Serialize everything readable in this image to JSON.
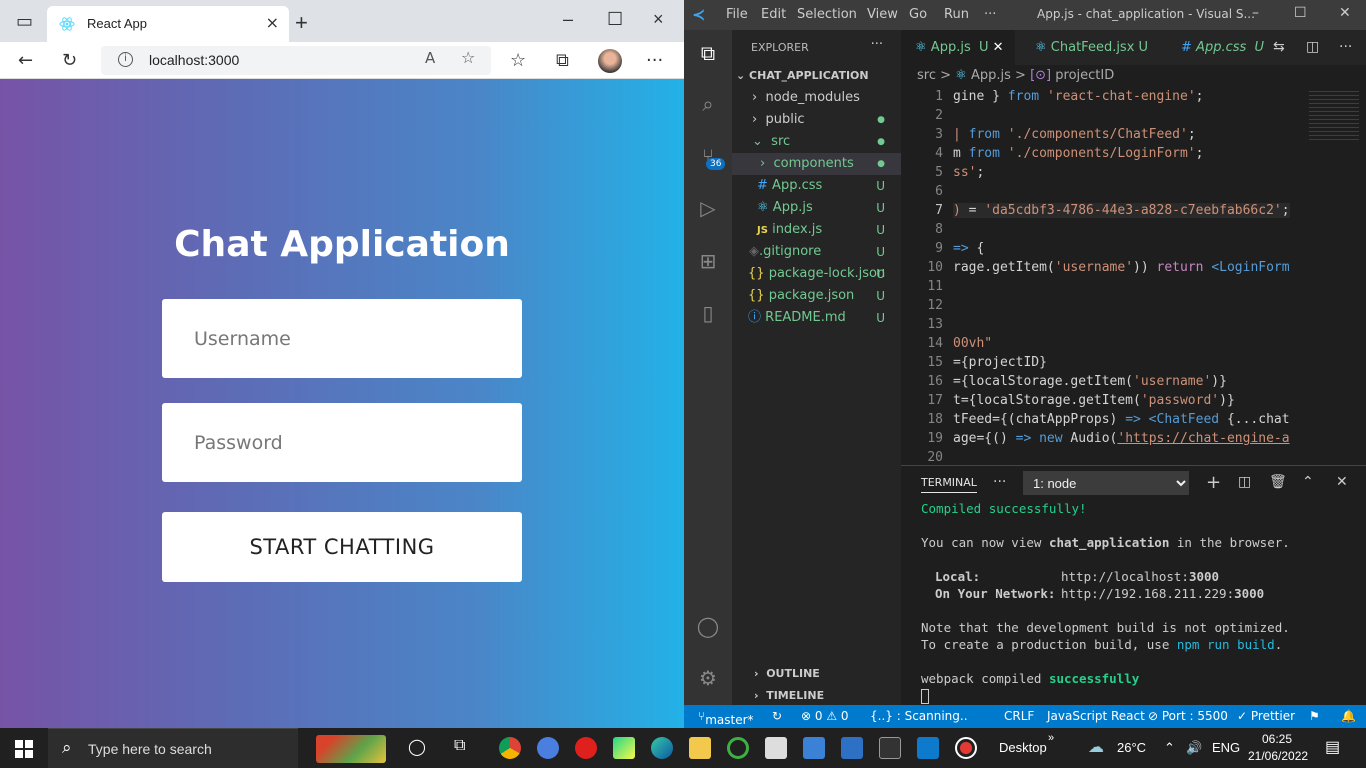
{
  "browser": {
    "tab_title": "React App",
    "url": "localhost:3000"
  },
  "app": {
    "heading": "Chat Application",
    "username_placeholder": "Username",
    "password_placeholder": "Password",
    "button": "START CHATTING"
  },
  "vscode": {
    "menu": [
      "File",
      "Edit",
      "Selection",
      "View",
      "Go",
      "Run",
      "···"
    ],
    "window_title": "App.js - chat_application - Visual S...",
    "explorer": "EXPLORER",
    "project": "CHAT_APPLICATION",
    "tree": [
      {
        "name": "node_modules",
        "status": ""
      },
      {
        "name": "public",
        "status": "●"
      },
      {
        "name": "src",
        "status": "●"
      },
      {
        "name": "components",
        "status": "●"
      },
      {
        "name": "App.css",
        "status": "U"
      },
      {
        "name": "App.js",
        "status": "U"
      },
      {
        "name": "index.js",
        "status": "U"
      },
      {
        "name": ".gitignore",
        "status": "U"
      },
      {
        "name": "package-lock.json",
        "status": "U"
      },
      {
        "name": "package.json",
        "status": "U"
      },
      {
        "name": "README.md",
        "status": "U"
      }
    ],
    "scm_badge": "36",
    "outline": "OUTLINE",
    "timeline": "TIMELINE",
    "tabs": [
      "App.js",
      "U",
      "ChatFeed.jsx",
      "U",
      "App.css",
      "U"
    ],
    "breadcrumb": [
      "src",
      ">",
      "App.js",
      ">",
      "projectID"
    ],
    "lines": [
      "1",
      "2",
      "3",
      "4",
      "5",
      "6",
      "7",
      "8",
      "9",
      "10",
      "11",
      "12",
      "13",
      "14",
      "15",
      "16",
      "17",
      "18",
      "19",
      "20"
    ],
    "terminal": {
      "label": "TERMINAL",
      "shell": "1: node",
      "l1": "Compiled successfully!",
      "l2a": "You can now view ",
      "l2b": "chat_application",
      "l2c": " in the browser.",
      "l3a": "Local:",
      "l3b": "http://localhost:",
      "l3c": "3000",
      "l4a": "On Your Network:",
      "l4b": "http://192.168.211.229:",
      "l4c": "3000",
      "l5": "Note that the development build is not optimized.",
      "l6a": "To create a production build, use ",
      "l6b": "npm run build",
      "l7a": "webpack compiled ",
      "l7b": "successfully"
    },
    "status": {
      "branch": "master*",
      "errors": "⊗ 0 ⚠ 0",
      "scan": "{..} : Scanning..",
      "eol": "CRLF",
      "lang": "JavaScript React",
      "port": "⊘ Port : 5500",
      "prettier": "✓ Prettier"
    }
  },
  "taskbar": {
    "search": "Type here to search",
    "desktop": "Desktop",
    "temp": "26°C",
    "lang": "ENG",
    "time": "06:25",
    "date": "21/06/2022"
  }
}
